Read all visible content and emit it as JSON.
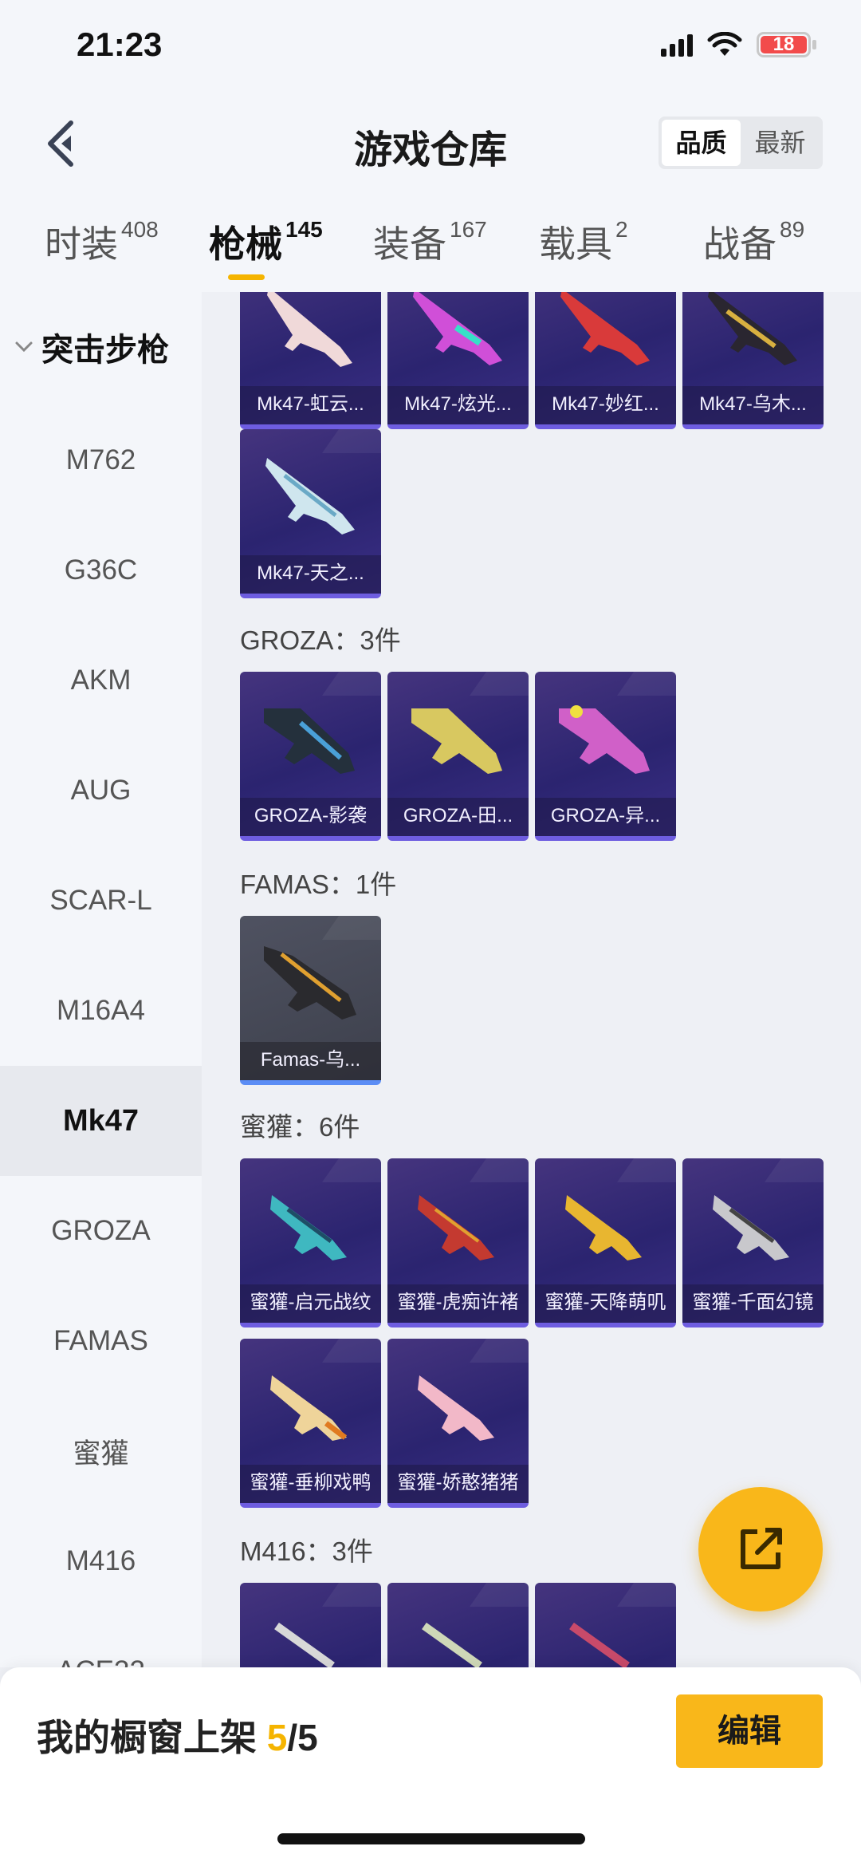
{
  "status_bar": {
    "time": "21:23",
    "battery": "18"
  },
  "header": {
    "title": "游戏仓库",
    "sort": {
      "quality": "品质",
      "newest": "最新"
    }
  },
  "tabs": [
    {
      "label": "时装",
      "count": "408"
    },
    {
      "label": "枪械",
      "count": "145"
    },
    {
      "label": "装备",
      "count": "167"
    },
    {
      "label": "载具",
      "count": "2"
    },
    {
      "label": "战备",
      "count": "89"
    }
  ],
  "sidebar": {
    "group": "突击步枪",
    "items": [
      "M762",
      "G36C",
      "AKM",
      "AUG",
      "SCAR-L",
      "M16A4",
      "Mk47",
      "GROZA",
      "FAMAS",
      "蜜獾",
      "M416",
      "ACE32"
    ]
  },
  "content": {
    "mk47_cards": [
      "Mk47-虹云...",
      "Mk47-炫光...",
      "Mk47-妙红...",
      "Mk47-乌木...",
      "Mk47-天之..."
    ],
    "groza": {
      "heading": "GROZA：3件",
      "cards": [
        "GROZA-影袭",
        "GROZA-田...",
        "GROZA-异..."
      ]
    },
    "famas": {
      "heading": "FAMAS：1件",
      "cards": [
        "Famas-乌..."
      ]
    },
    "honey_badger": {
      "heading": "蜜獾：6件",
      "cards": [
        "蜜獾-启元战纹",
        "蜜獾-虎痴许褚",
        "蜜獾-天降萌叽",
        "蜜獾-千面幻镜",
        "蜜獾-垂柳戏鸭",
        "蜜獾-娇憨猪猪"
      ]
    },
    "m416": {
      "heading": "M416：3件"
    }
  },
  "bottom": {
    "shelf_prefix": "我的橱窗上架 ",
    "shelf_count": "5",
    "shelf_total": "/5",
    "edit_label": "编辑"
  },
  "colors": {
    "accent": "#f9b71a",
    "card_purple": "#2b2470",
    "card_border": "#6e5de0"
  }
}
